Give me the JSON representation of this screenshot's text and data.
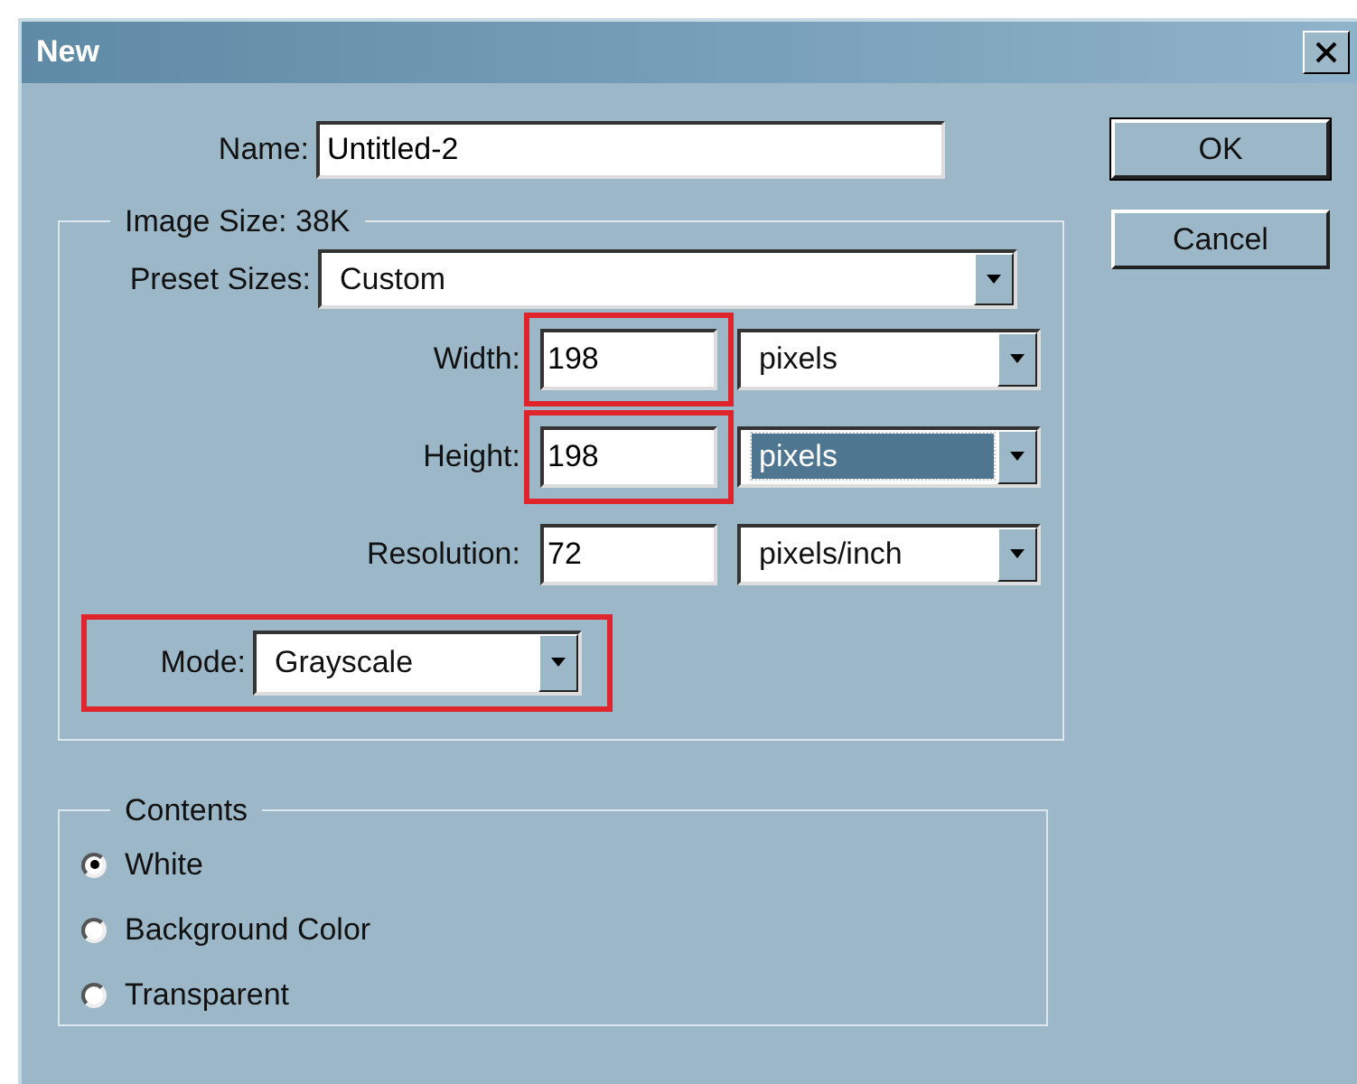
{
  "window": {
    "title": "New"
  },
  "name_field": {
    "label": "Name:",
    "value": "Untitled-2"
  },
  "image_size": {
    "legend": "Image Size: 38K",
    "preset": {
      "label": "Preset Sizes:",
      "value": "Custom"
    },
    "rows": [
      {
        "label": "Width:",
        "value": "198",
        "unit": "pixels",
        "highlighted": true,
        "unit_focused": false
      },
      {
        "label": "Height:",
        "value": "198",
        "unit": "pixels",
        "highlighted": true,
        "unit_focused": true
      },
      {
        "label": "Resolution:",
        "value": "72",
        "unit": "pixels/inch",
        "highlighted": false,
        "unit_focused": false
      }
    ],
    "mode": {
      "label": "Mode:",
      "value": "Grayscale",
      "highlighted": true
    }
  },
  "contents": {
    "legend": "Contents",
    "options": [
      {
        "label": "White",
        "selected": true
      },
      {
        "label": "Background Color",
        "selected": false
      },
      {
        "label": "Transparent",
        "selected": false
      }
    ]
  },
  "buttons": [
    "OK",
    "Cancel"
  ]
}
